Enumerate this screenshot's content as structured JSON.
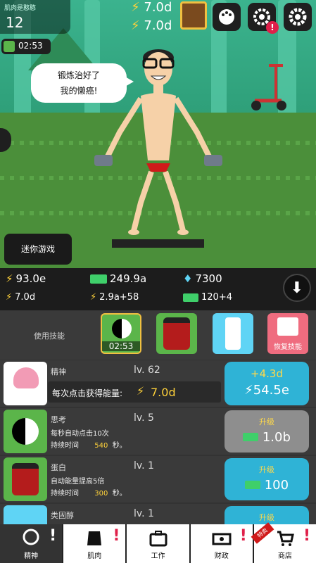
{
  "header": {
    "title": "肌肉是憨憨",
    "level": "12",
    "timer": "02:53",
    "boost1": "7.0d",
    "boost2": "7.0d"
  },
  "speech": {
    "line1": "锻炼治好了",
    "line2": "我的懒癌!"
  },
  "mini_game_label": "迷你游戏",
  "stats": {
    "energy": "93.0e",
    "cash": "249.9a",
    "gems": "7300",
    "tap": "7.0d",
    "energy_rate": "2.9a+58",
    "cash_rate": "120+4"
  },
  "skills": {
    "label": "使用技能",
    "timer": "02:53",
    "restore_label": "恢复技能"
  },
  "rows": [
    {
      "name": "精神",
      "level": "lv. 62",
      "desc1": "每次点击获得能量:",
      "desc_val": "7.0d",
      "upgrade_top": "+4.3d",
      "upgrade_val": "54.5e"
    },
    {
      "name": "思考",
      "level": "lv. 5",
      "desc1": "每秒自动点击10次",
      "desc2_label": "持续时间",
      "desc2_val": "540",
      "desc2_unit": "秒。",
      "upgrade_top": "升级",
      "upgrade_val": "1.0b"
    },
    {
      "name": "蛋白",
      "level": "lv. 1",
      "desc1": "自动能量提高5倍",
      "desc2_label": "持续时间",
      "desc2_val": "300",
      "desc2_unit": "秒。",
      "upgrade_top": "升级",
      "upgrade_val": "100"
    },
    {
      "name": "类固醇",
      "level": "lv. 1",
      "upgrade_top": "升级"
    }
  ],
  "nav": [
    {
      "label": "精神"
    },
    {
      "label": "肌肉"
    },
    {
      "label": "工作"
    },
    {
      "label": "财政"
    },
    {
      "label": "商店",
      "badge": "特卖"
    }
  ]
}
